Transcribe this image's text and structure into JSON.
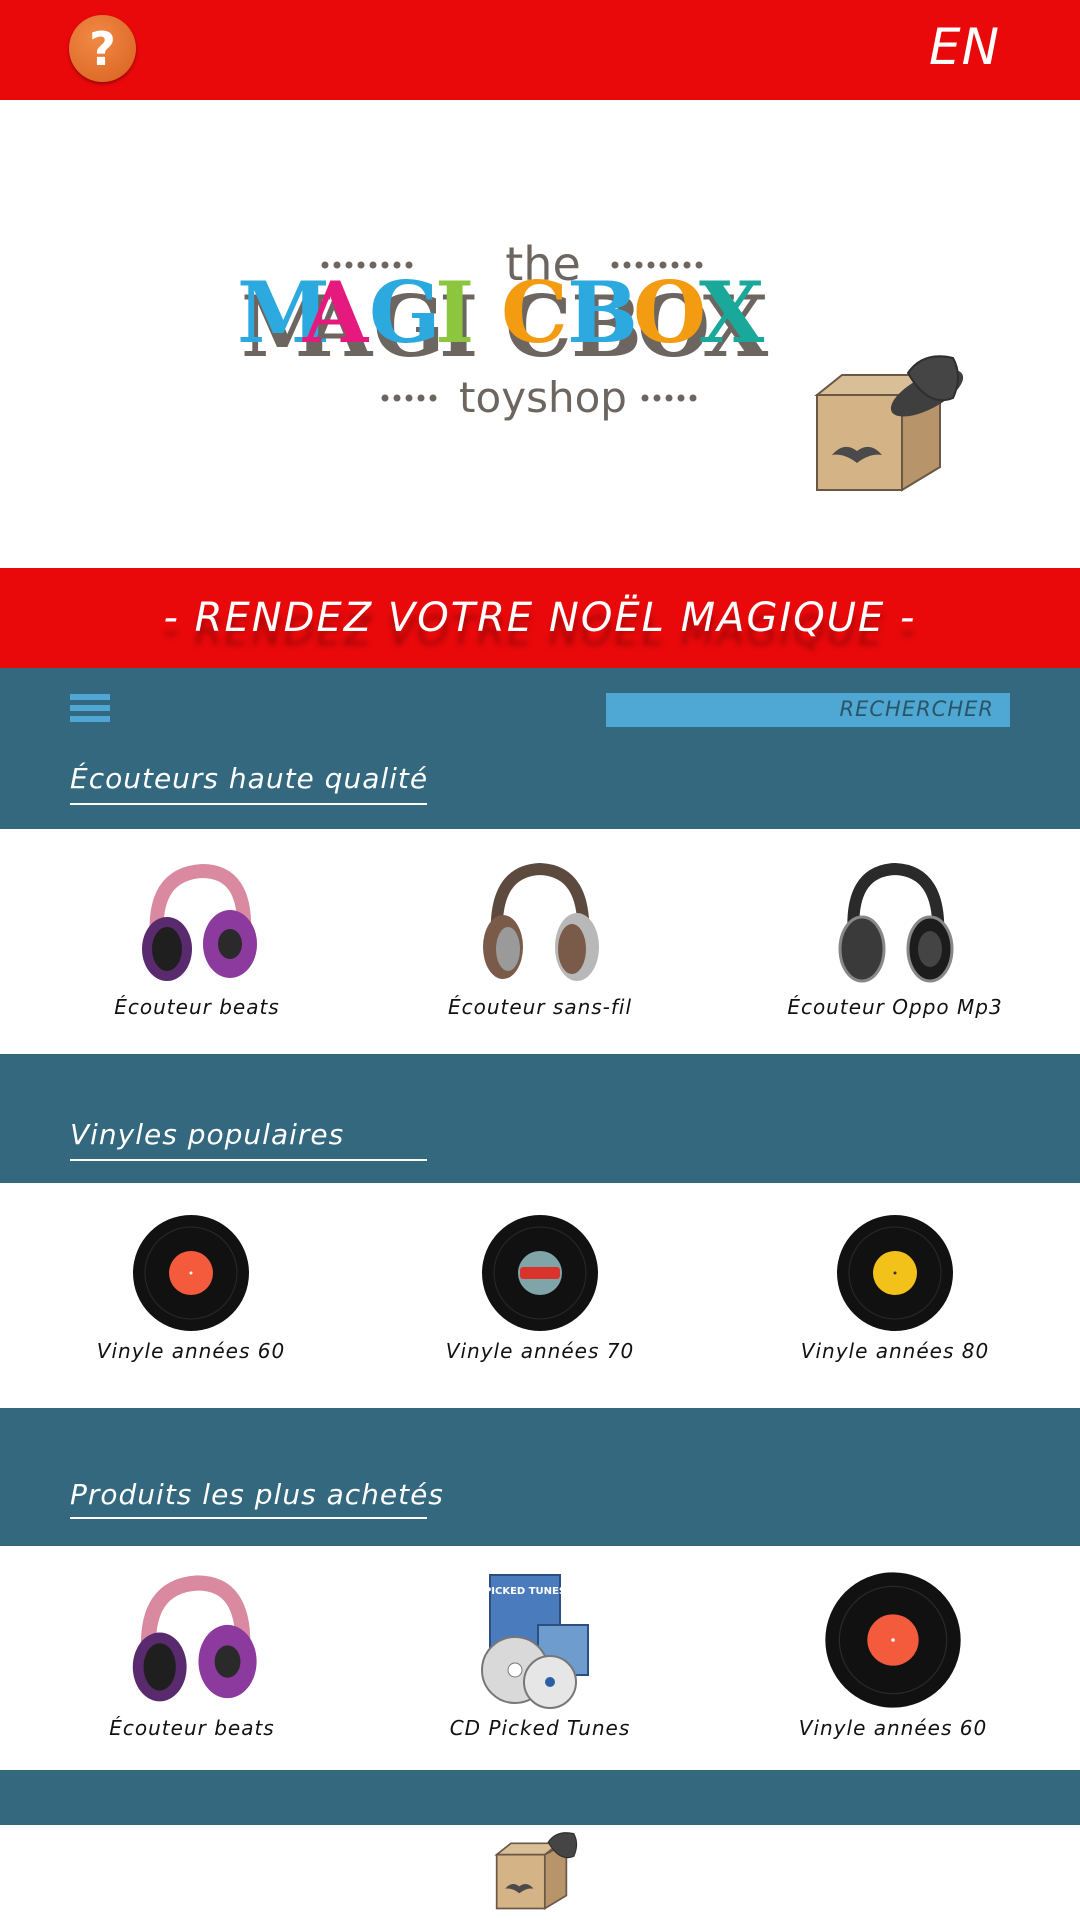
{
  "header": {
    "help_icon": "question-mark-icon",
    "help_label": "?",
    "language": "EN",
    "colors": {
      "bar": "#e9090b",
      "help": "#e06d2a"
    }
  },
  "logo": {
    "the": "the",
    "brand": "MAGICBOX",
    "sub": "toyshop",
    "letter_colors": [
      "#2ca9de",
      "#e5197e",
      "#2ca9de",
      "#8cc63f",
      "#f39c12",
      "#2ca9de",
      "#f39c12",
      "#1aa89a",
      "#e5197e"
    ]
  },
  "banner": {
    "text": "- RENDEZ VOTRE NOËL MAGIQUE -"
  },
  "nav": {
    "menu_icon": "hamburger-menu-icon",
    "search_placeholder": "RECHERCHER"
  },
  "sections": [
    {
      "title": "Écouteurs haute qualité",
      "products": [
        {
          "label": "Écouteur beats",
          "icon": "headphones-purple-icon"
        },
        {
          "label": "Écouteur sans-fil",
          "icon": "headphones-brown-icon"
        },
        {
          "label": "Écouteur Oppo Mp3",
          "icon": "headphones-black-icon"
        }
      ]
    },
    {
      "title": "Vinyles populaires",
      "products": [
        {
          "label": "Vinyle années 60",
          "icon": "vinyl-red-icon"
        },
        {
          "label": "Vinyle années 70",
          "icon": "vinyl-retro-icon"
        },
        {
          "label": "Vinyle années 80",
          "icon": "vinyl-yellow-icon"
        }
      ]
    },
    {
      "title": "Produits les plus achetés",
      "products": [
        {
          "label": "Écouteur beats",
          "icon": "headphones-purple-icon"
        },
        {
          "label": "CD Picked Tunes",
          "icon": "cd-picked-tunes-icon"
        },
        {
          "label": "Vinyle années 60",
          "icon": "vinyl-red-icon"
        }
      ]
    }
  ],
  "cd_art": {
    "title": "PICKED TUNES"
  },
  "footer": {
    "icon": "magicbox-mascot-icon"
  }
}
